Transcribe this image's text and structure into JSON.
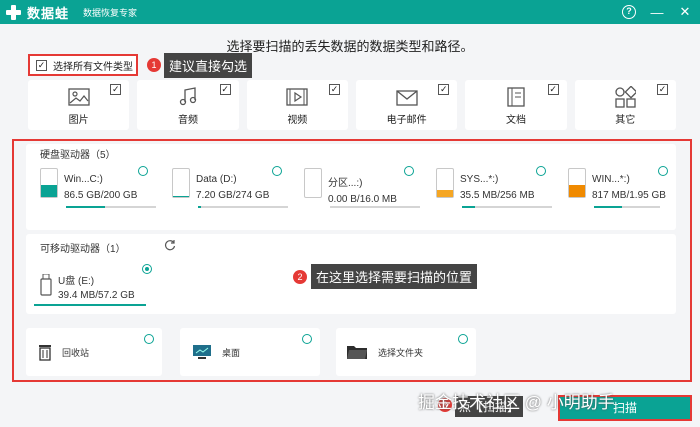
{
  "titlebar": {
    "app_name": "数据蛙",
    "subtitle": "数据恢复专家",
    "help_glyph": "?",
    "minimize_glyph": "—",
    "close_glyph": "✕"
  },
  "instruction": "选择要扫描的丢失数据的数据类型和路径。",
  "select_all": {
    "label": "选择所有文件类型",
    "checked": true
  },
  "callouts": [
    {
      "num": "1",
      "text": "建议直接勾选"
    },
    {
      "num": "2",
      "text": "在这里选择需要扫描的位置"
    },
    {
      "num": "3",
      "text": "点【扫描】"
    }
  ],
  "file_types": [
    {
      "label": "图片",
      "icon": "image-icon",
      "checked": true
    },
    {
      "label": "音频",
      "icon": "music-icon",
      "checked": true
    },
    {
      "label": "视频",
      "icon": "video-icon",
      "checked": true
    },
    {
      "label": "电子邮件",
      "icon": "mail-icon",
      "checked": true
    },
    {
      "label": "文档",
      "icon": "document-icon",
      "checked": true
    },
    {
      "label": "其它",
      "icon": "other-icon",
      "checked": true
    }
  ],
  "hard_drives": {
    "title": "硬盘驱动器（5）",
    "items": [
      {
        "name": "Win...C:)",
        "size": "86.5 GB/200 GB",
        "used_fraction": 0.43,
        "color": "#0aa394"
      },
      {
        "name": "Data (D:)",
        "size": "7.20 GB/274 GB",
        "used_fraction": 0.03,
        "color": "#0aa394"
      },
      {
        "name": "分区...:)",
        "size": "0.00  B/16.0 MB",
        "used_fraction": 0.0,
        "color": "#0aa394"
      },
      {
        "name": "SYS...*:)",
        "size": "35.5 MB/256 MB",
        "used_fraction": 0.14,
        "color": "#f5a623"
      },
      {
        "name": "WIN...*:)",
        "size": "817 MB/1.95 GB",
        "used_fraction": 0.42,
        "color": "#f08a00"
      }
    ]
  },
  "removable": {
    "title": "可移动驱动器（1）",
    "refresh_icon": "refresh-icon",
    "items": [
      {
        "name": "U盘 (E:)",
        "size": "39.4 MB/57.2 GB",
        "used_fraction": 0.001,
        "selected": true
      }
    ]
  },
  "locations": [
    {
      "label": "回收站",
      "icon": "recycle-bin-icon"
    },
    {
      "label": "桌面",
      "icon": "desktop-icon"
    },
    {
      "label": "选择文件夹",
      "icon": "folder-icon"
    }
  ],
  "watermark": "掘金技术社区 @ 小明助手",
  "scan_button": "扫描"
}
